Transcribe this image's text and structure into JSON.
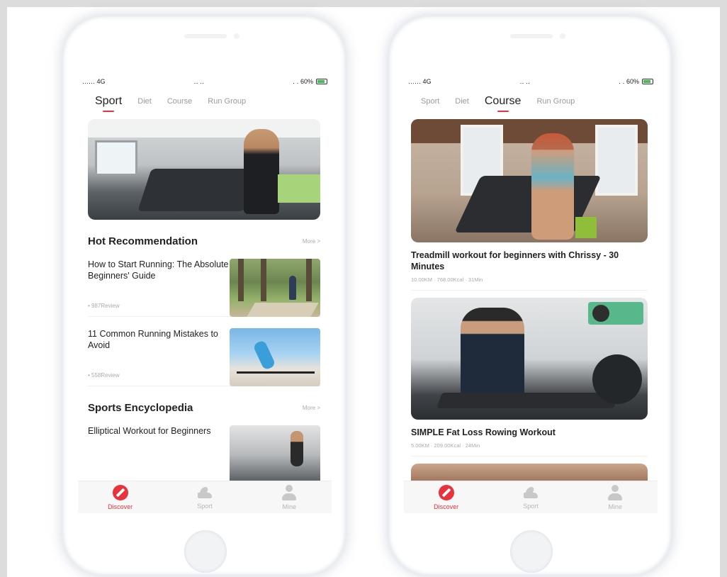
{
  "left_phone": {
    "status": {
      "carrier": "…․․․ 4G",
      "time": "․․ ․․",
      "battery": "․ ․ 60%"
    },
    "tabs": [
      "Sport",
      "Diet",
      "Course",
      "Run Group"
    ],
    "active_tab": "Sport",
    "sections": {
      "hot": {
        "title": "Hot Recommendation",
        "more": "More >"
      },
      "encyclopedia": {
        "title": "Sports Encyclopedia",
        "more": "More >"
      }
    },
    "articles": [
      {
        "title": "How to Start Running: The Absolute Beginners' Guide",
        "meta": "• 987Review"
      },
      {
        "title": "11 Common Running Mistakes to Avoid",
        "meta": "• 558Review"
      },
      {
        "title": "Elliptical Workout for Beginners"
      }
    ],
    "tabbar": [
      "Discover",
      "Sport",
      "Mine"
    ]
  },
  "right_phone": {
    "status": {
      "carrier": "…․․․ 4G",
      "time": "․․ ․․",
      "battery": "․ ․ 60%"
    },
    "tabs": [
      "Sport",
      "Diet",
      "Course",
      "Run Group"
    ],
    "active_tab": "Course",
    "courses": [
      {
        "title": "Treadmill workout for beginners with Chrissy - 30 Minutes",
        "meta": "10.00KM · 768.00Kcal · 31Min"
      },
      {
        "title": "SIMPLE Fat Loss Rowing Workout",
        "meta": "5.00KM · 209.00Kcal · 24Min"
      }
    ],
    "tabbar": [
      "Discover",
      "Sport",
      "Mine"
    ]
  },
  "colors": {
    "accent": "#e8323c",
    "muted": "#aaaaaa",
    "background": "#dcdcdc"
  },
  "icons": [
    "discover-icon",
    "shoe-icon",
    "person-icon"
  ]
}
